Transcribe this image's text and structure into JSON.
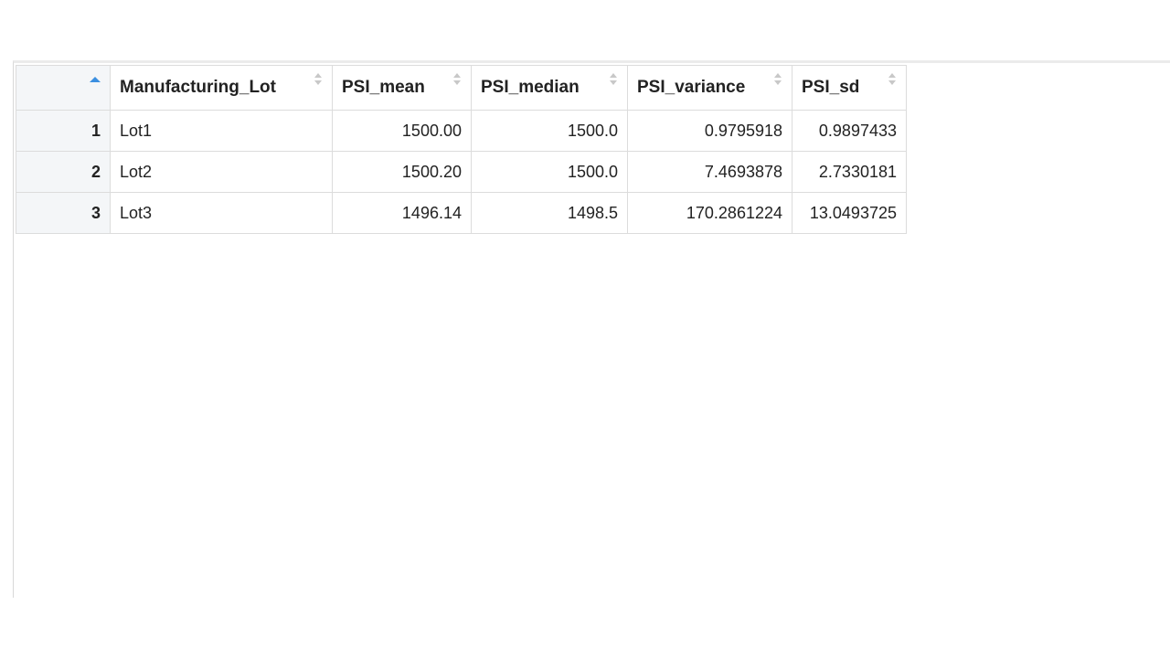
{
  "table": {
    "columns": [
      "Manufacturing_Lot",
      "PSI_mean",
      "PSI_median",
      "PSI_variance",
      "PSI_sd"
    ],
    "rows": [
      {
        "n": "1",
        "lot": "Lot1",
        "mean": "1500.00",
        "median": "1500.0",
        "variance": "0.9795918",
        "sd": "0.9897433"
      },
      {
        "n": "2",
        "lot": "Lot2",
        "mean": "1500.20",
        "median": "1500.0",
        "variance": "7.4693878",
        "sd": "2.7330181"
      },
      {
        "n": "3",
        "lot": "Lot3",
        "mean": "1496.14",
        "median": "1498.5",
        "variance": "170.2861224",
        "sd": "13.0493725"
      }
    ]
  },
  "colors": {
    "sort_active": "#3b8fe0",
    "rownum_bg": "#f4f6f8",
    "grid_border": "#dcdcdc"
  }
}
